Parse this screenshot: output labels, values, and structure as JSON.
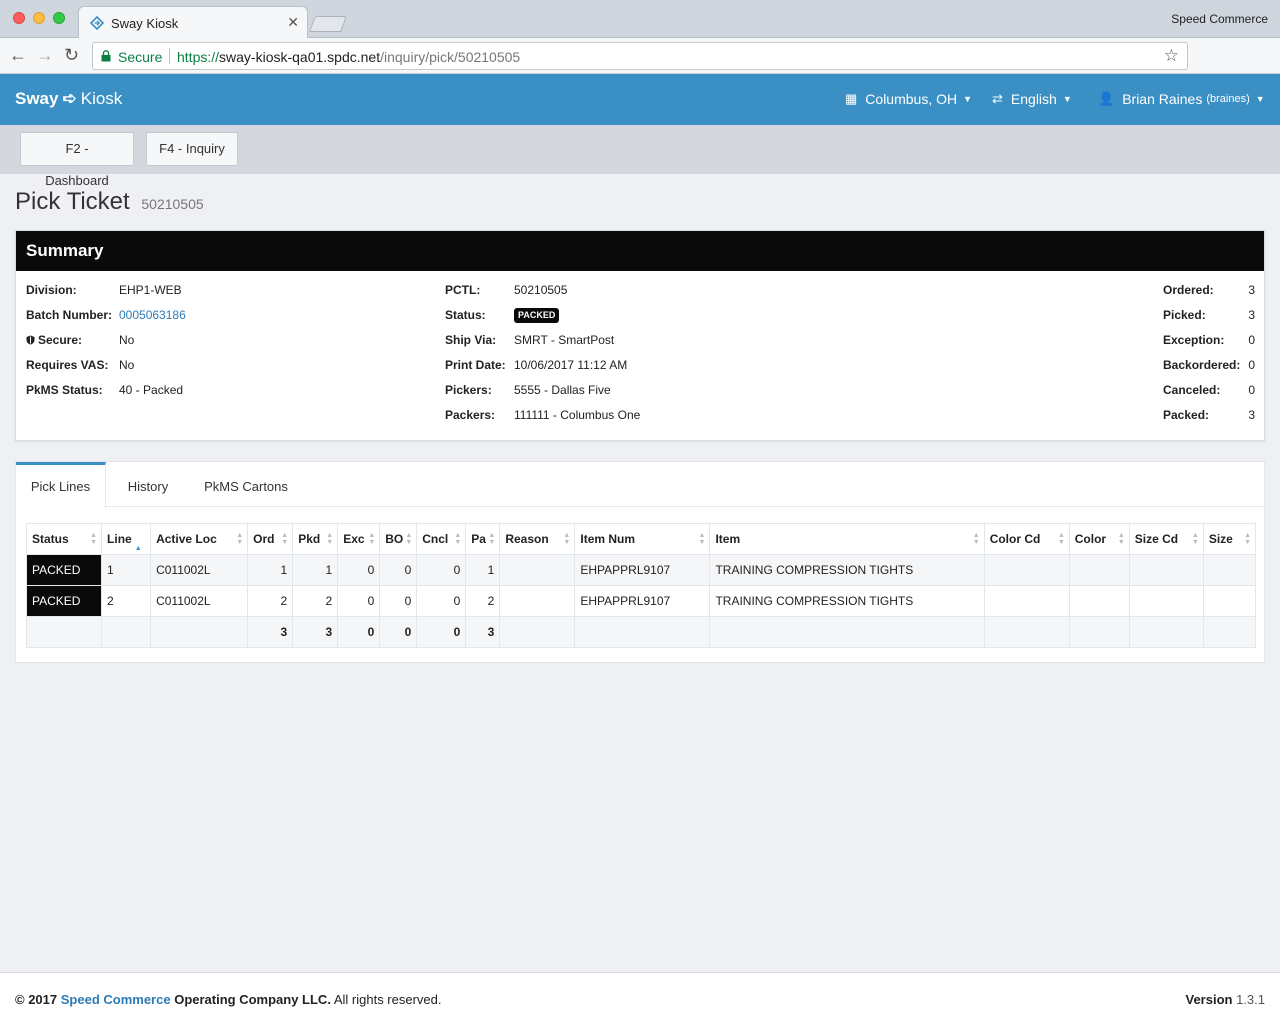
{
  "browser": {
    "tab_title": "Sway Kiosk",
    "tab_close": "✕",
    "profile": "Speed Commerce",
    "secure_label": "Secure",
    "url_scheme": "https://",
    "url_host": "sway-kiosk-qa01.spdc.net",
    "url_path": "/inquiry/pick/50210505"
  },
  "navbar": {
    "brand_left": "Sway",
    "brand_right": "Kiosk",
    "location": "Columbus, OH",
    "language": "English",
    "user_name": "Brian Raines",
    "user_login": "(braines)"
  },
  "function_bar": {
    "dashboard": "F2 - Dashboard",
    "inquiry": "F4 - Inquiry"
  },
  "page": {
    "title": "Pick Ticket",
    "subtitle": "50210505"
  },
  "summary": {
    "heading": "Summary",
    "division_label": "Division:",
    "division": "EHP1-WEB",
    "batch_label": "Batch Number:",
    "batch": "0005063186",
    "secure_label": "Secure:",
    "secure": "No",
    "vas_label": "Requires VAS:",
    "vas": "No",
    "pkms_label": "PkMS Status:",
    "pkms": "40 - Packed",
    "pctl_label": "PCTL:",
    "pctl": "50210505",
    "status_label": "Status:",
    "status": "PACKED",
    "shipvia_label": "Ship Via:",
    "shipvia": "SMRT - SmartPost",
    "printdate_label": "Print Date:",
    "printdate": "10/06/2017 11:12 AM",
    "pickers_label": "Pickers:",
    "pickers": "5555 - Dallas Five",
    "packers_label": "Packers:",
    "packers": "111111 - Columbus One",
    "ordered_label": "Ordered:",
    "ordered": "3",
    "picked_label": "Picked:",
    "picked": "3",
    "exception_label": "Exception:",
    "exception": "0",
    "backordered_label": "Backordered:",
    "backordered": "0",
    "canceled_label": "Canceled:",
    "canceled": "0",
    "packed_label": "Packed:",
    "packed": "3"
  },
  "tabs": {
    "pick_lines": "Pick Lines",
    "history": "History",
    "pkms_cartons": "PkMS Cartons"
  },
  "table": {
    "headers": [
      "Status",
      "Line",
      "Active Loc",
      "Ord",
      "Pkd",
      "Exc",
      "BO",
      "Cncl",
      "Pa",
      "Reason",
      "Item Num",
      "Item",
      "Color Cd",
      "Color",
      "Size Cd",
      "Size"
    ],
    "rows": [
      [
        "PACKED",
        "1",
        "C011002L",
        "1",
        "1",
        "0",
        "0",
        "0",
        "1",
        "",
        "EHPAPPRL9107",
        "TRAINING COMPRESSION TIGHTS",
        "",
        "",
        "",
        ""
      ],
      [
        "PACKED",
        "2",
        "C011002L",
        "2",
        "2",
        "0",
        "0",
        "0",
        "2",
        "",
        "EHPAPPRL9107",
        "TRAINING COMPRESSION TIGHTS",
        "",
        "",
        "",
        ""
      ]
    ],
    "totals": [
      "",
      "",
      "",
      "3",
      "3",
      "0",
      "0",
      "0",
      "3",
      "",
      "",
      "",
      "",
      "",
      "",
      ""
    ]
  },
  "footer": {
    "copyright": "© 2017",
    "company": "Speed Commerce",
    "company_rest": "Operating Company LLC.",
    "rights": "All rights reserved.",
    "version_label": "Version",
    "version": "1.3.1"
  },
  "colors": {
    "navbar": "#3a8fc4",
    "summary_header": "#0a0a0a",
    "link": "#2c7bb6"
  }
}
